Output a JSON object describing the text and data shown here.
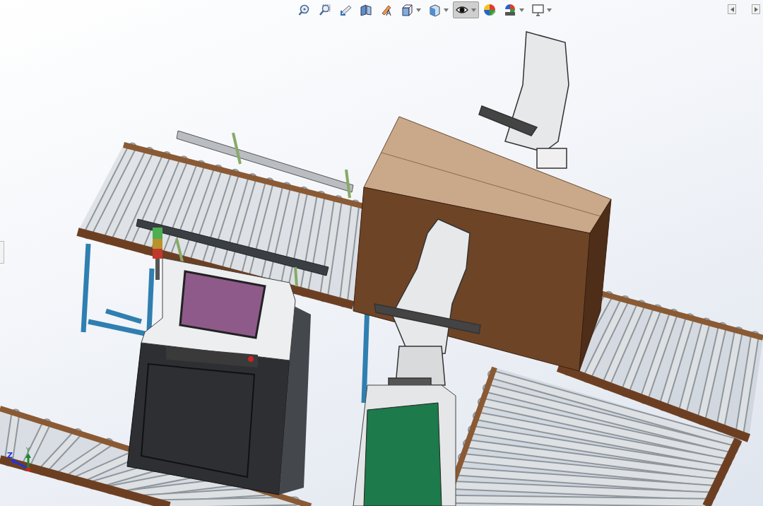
{
  "toolbar": {
    "items": [
      {
        "selected": false,
        "dropdown": false
      },
      {
        "selected": false,
        "dropdown": false
      },
      {
        "selected": false,
        "dropdown": false
      },
      {
        "selected": false,
        "dropdown": false
      },
      {
        "selected": false,
        "dropdown": false
      },
      {
        "selected": false,
        "dropdown": true
      },
      {
        "selected": false,
        "dropdown": true
      },
      {
        "selected": true,
        "dropdown": true
      },
      {
        "selected": false,
        "dropdown": false
      },
      {
        "selected": false,
        "dropdown": true
      },
      {
        "selected": false,
        "dropdown": true
      }
    ]
  },
  "triad": {
    "labels": [
      "Y",
      "Z"
    ]
  }
}
